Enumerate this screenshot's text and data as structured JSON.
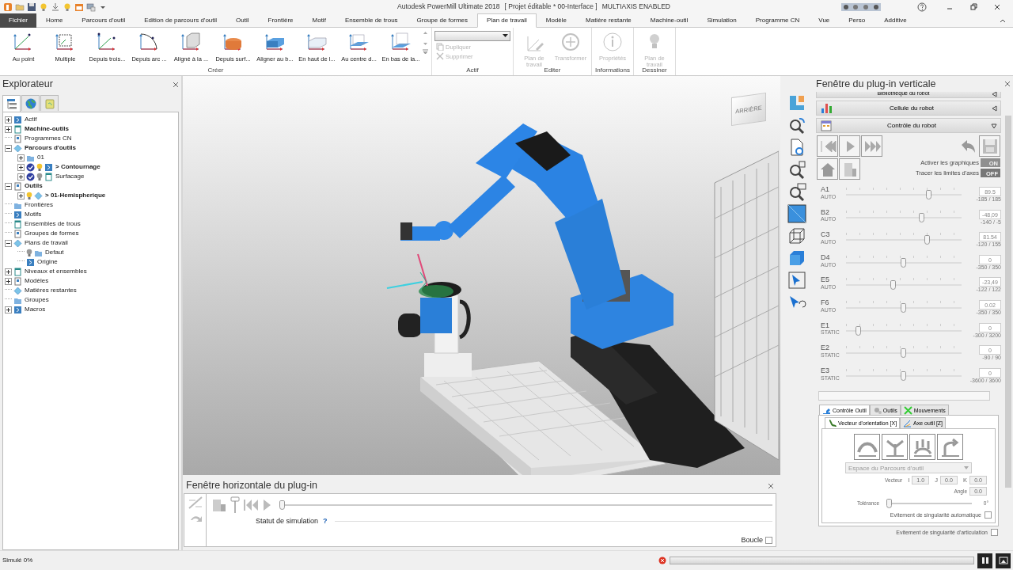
{
  "title_bar": {
    "title": "Autodesk PowerMill Ultimate 2018",
    "project": "[ Projet éditable * 00-Interface ]",
    "mode": "MULTIAXIS ENABLED"
  },
  "ribbon_tabs": [
    {
      "kind": "file",
      "label": "Fichier",
      "selected": false
    },
    {
      "kind": "tab",
      "label": "Home",
      "selected": false
    },
    {
      "kind": "tab",
      "label": "Parcours d'outil",
      "selected": false
    },
    {
      "kind": "tab",
      "label": "Edition de parcours d'outil",
      "selected": false
    },
    {
      "kind": "tab",
      "label": "Outil",
      "selected": false
    },
    {
      "kind": "tab",
      "label": "Frontière",
      "selected": false
    },
    {
      "kind": "tab",
      "label": "Motif",
      "selected": false
    },
    {
      "kind": "tab",
      "label": "Ensemble de trous",
      "selected": false
    },
    {
      "kind": "tab",
      "label": "Groupe de formes",
      "selected": false
    },
    {
      "kind": "tab",
      "label": "Plan de travail",
      "selected": true
    },
    {
      "kind": "tab",
      "label": "Modèle",
      "selected": false
    },
    {
      "kind": "tab",
      "label": "Matière restante",
      "selected": false
    },
    {
      "kind": "tab",
      "label": "Machine-outil",
      "selected": false
    },
    {
      "kind": "tab",
      "label": "Simulation",
      "selected": false
    },
    {
      "kind": "tab",
      "label": "Programme CN",
      "selected": false
    },
    {
      "kind": "tab",
      "label": "Vue",
      "selected": false
    },
    {
      "kind": "tab",
      "label": "Perso",
      "selected": false
    },
    {
      "kind": "tab",
      "label": "Additive",
      "selected": false
    }
  ],
  "ribbon_groups": [
    {
      "label": "Créer",
      "items": [
        {
          "kind": "large",
          "label": "Au point",
          "disabled": false
        },
        {
          "kind": "large",
          "label": "Multiple",
          "disabled": false
        },
        {
          "kind": "large",
          "label": "Depuis trois...",
          "disabled": false
        },
        {
          "kind": "large",
          "label": "Depuis arc ...",
          "disabled": false
        },
        {
          "kind": "large",
          "label": "Aligné à la ...",
          "disabled": false
        },
        {
          "kind": "large",
          "label": "Depuis surf...",
          "disabled": false
        },
        {
          "kind": "large",
          "label": "Aligner au b...",
          "disabled": false
        },
        {
          "kind": "large",
          "label": "En haut de l...",
          "disabled": false
        },
        {
          "kind": "large",
          "label": "Au centre d...",
          "disabled": false
        },
        {
          "kind": "large",
          "label": "En bas de la...",
          "disabled": false
        }
      ]
    },
    {
      "label": "Actif",
      "items": [
        {
          "kind": "dropdown",
          "disabled": false
        },
        {
          "kind": "small",
          "label": "Dupliquer",
          "disabled": true
        },
        {
          "kind": "small",
          "label": "Supprimer",
          "disabled": true
        }
      ]
    },
    {
      "label": "Editer",
      "items": [
        {
          "kind": "large",
          "label": "Plan de travail",
          "disabled": true
        },
        {
          "kind": "large",
          "label": "Transformer",
          "disabled": true
        }
      ]
    },
    {
      "label": "Informations",
      "items": [
        {
          "kind": "large",
          "label": "Propriétés",
          "disabled": true
        }
      ]
    },
    {
      "label": "Dessiner",
      "items": [
        {
          "kind": "large",
          "label": "Plan de travail",
          "disabled": true
        }
      ]
    }
  ],
  "explorer": {
    "title": "Explorateur",
    "tabs": [
      {
        "selected": true
      },
      {
        "selected": false
      },
      {
        "selected": false
      }
    ],
    "tree": [
      {
        "label": "Actif",
        "kind": "collapsed",
        "bold": false
      },
      {
        "label": "Machine-outils",
        "kind": "collapsed",
        "bold": true
      },
      {
        "label": "Programmes CN",
        "kind": "leaf",
        "bold": false
      },
      {
        "label": "Parcours d'outils",
        "kind": "expanded",
        "bold": true,
        "children": [
          {
            "label": "01",
            "kind": "collapsed",
            "bold": false
          },
          {
            "label": "> Contournage",
            "kind": "collapsed",
            "bold": true,
            "checked": true,
            "light_on": true
          },
          {
            "label": "Surfacage",
            "kind": "collapsed",
            "bold": false,
            "checked": true,
            "light_on": false
          }
        ]
      },
      {
        "label": "Outils",
        "kind": "expanded",
        "bold": true,
        "children": [
          {
            "label": "> 01-Hemispherique",
            "kind": "collapsed",
            "bold": true,
            "light_on": true
          }
        ]
      },
      {
        "label": "Frontières",
        "kind": "leaf",
        "bold": false
      },
      {
        "label": "Motifs",
        "kind": "leaf",
        "bold": false
      },
      {
        "label": "Ensembles de trous",
        "kind": "leaf",
        "bold": false
      },
      {
        "label": "Groupes de formes",
        "kind": "leaf",
        "bold": false
      },
      {
        "label": "Plans de travail",
        "kind": "expanded",
        "bold": false,
        "children": [
          {
            "label": "Defaut",
            "kind": "leaf",
            "bold": false,
            "light_on": false
          },
          {
            "label": "Origine",
            "kind": "leaf",
            "bold": false
          }
        ]
      },
      {
        "label": "Niveaux et ensembles",
        "kind": "collapsed",
        "bold": false
      },
      {
        "label": "Modèles",
        "kind": "collapsed",
        "bold": false
      },
      {
        "label": "Matières restantes",
        "kind": "leaf",
        "bold": false
      },
      {
        "label": "Groupes",
        "kind": "leaf",
        "bold": false
      },
      {
        "label": "Macros",
        "kind": "collapsed",
        "bold": false
      }
    ]
  },
  "viewport": {
    "view_cube_label": "ARRIÈRE"
  },
  "horizontal_plugin": {
    "title": "Fenêtre horizontale du plug-in",
    "status_label": "Statut de simulation",
    "help": "?",
    "level": 0.0,
    "loop_label": "Boucle",
    "loop_checked": false
  },
  "vertical_plugin": {
    "title": "Fenêtre du plug-in verticale",
    "sections": [
      {
        "label": "Bibliothèque du robot",
        "expanded": false
      },
      {
        "label": "Cellule du robot",
        "expanded": false
      },
      {
        "label": "Contrôle du robot",
        "expanded": true
      }
    ],
    "toggles": [
      {
        "label": "Activer les graphiques",
        "value": "ON",
        "on": true
      },
      {
        "label": "Tracer les limites d'axes",
        "value": "OFF",
        "on": false
      }
    ],
    "axes": [
      {
        "name": "A1",
        "mode": "AUTO",
        "level": 0.74,
        "value": "89.5",
        "range": "-185 / 185"
      },
      {
        "name": "B2",
        "mode": "AUTO",
        "level": 0.67,
        "value": "-48,09",
        "range": "-140 / -5"
      },
      {
        "name": "C3",
        "mode": "AUTO",
        "level": 0.72,
        "value": "81.54",
        "range": "-120 / 155"
      },
      {
        "name": "D4",
        "mode": "AUTO",
        "level": 0.5,
        "value": "0",
        "range": "-350 / 350"
      },
      {
        "name": "E5",
        "mode": "AUTO",
        "level": 0.41,
        "value": "-23,49",
        "range": "-122 / 122"
      },
      {
        "name": "F6",
        "mode": "AUTO",
        "level": 0.5,
        "value": "0.02",
        "range": "-350 / 350"
      },
      {
        "name": "E1",
        "mode": "STATIC",
        "level": 0.09,
        "value": "0",
        "range": "-300 / 3200"
      },
      {
        "name": "E2",
        "mode": "STATIC",
        "level": 0.5,
        "value": "0",
        "range": "-90 / 90"
      },
      {
        "name": "E3",
        "mode": "STATIC",
        "level": 0.5,
        "value": "0",
        "range": "-3600 / 3600"
      }
    ],
    "tabs": [
      {
        "label": "Contrôle Outil",
        "selected": true
      },
      {
        "label": "Outils",
        "selected": false
      },
      {
        "label": "Mouvements",
        "selected": false
      }
    ],
    "subtabs": [
      {
        "label": "Vecteur d'orientation [X]",
        "selected": true
      },
      {
        "label": "Axe outil [Z]",
        "selected": false
      }
    ],
    "space_select": "Espace du Parcours d'outil",
    "vector_label": "Vecteur",
    "vector": [
      {
        "label": "I",
        "value": "1.0"
      },
      {
        "label": "J",
        "value": "0.0"
      },
      {
        "label": "K",
        "value": "0.0"
      }
    ],
    "angle_label": "Angle",
    "angle": "0.0",
    "tolerance": {
      "label": "Tolérance",
      "level": 0.0,
      "value": "0°"
    },
    "checks": [
      {
        "label": "Evitement de singularité automatique",
        "checked": false
      },
      {
        "label": "Evitement de singularité d'articulation",
        "checked": false
      }
    ]
  },
  "status_bar": {
    "text": "Simulé 0%",
    "level": 0.0
  }
}
